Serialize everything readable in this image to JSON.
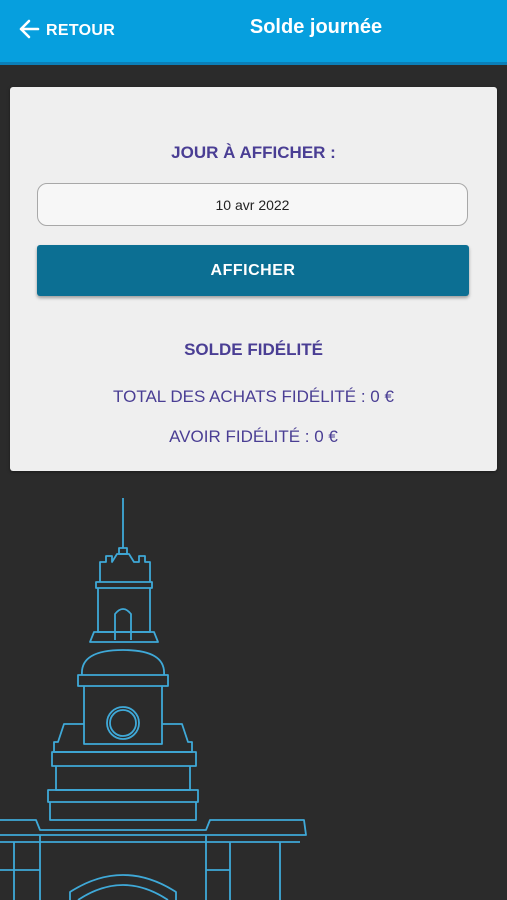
{
  "header": {
    "back_label": "RETOUR",
    "title": "Solde journée"
  },
  "form": {
    "day_label": "JOUR À AFFICHER :",
    "date_value": "10 avr 2022",
    "show_button_label": "AFFICHER"
  },
  "loyalty": {
    "section_title": "SOLDE FIDÉLITÉ",
    "total_purchases": "TOTAL DES ACHATS FIDÉLITÉ : 0 €",
    "credit": "AVOIR FIDÉLITÉ : 0 €"
  },
  "colors": {
    "header_bg": "#069fde",
    "button_bg": "#0c6f93",
    "label_text": "#4a3e94",
    "background": "#2b2b2b",
    "illustration_line": "#3fa9d8"
  },
  "icons": {
    "back": "arrow-left-icon",
    "illustration": "building-outline-illustration"
  }
}
